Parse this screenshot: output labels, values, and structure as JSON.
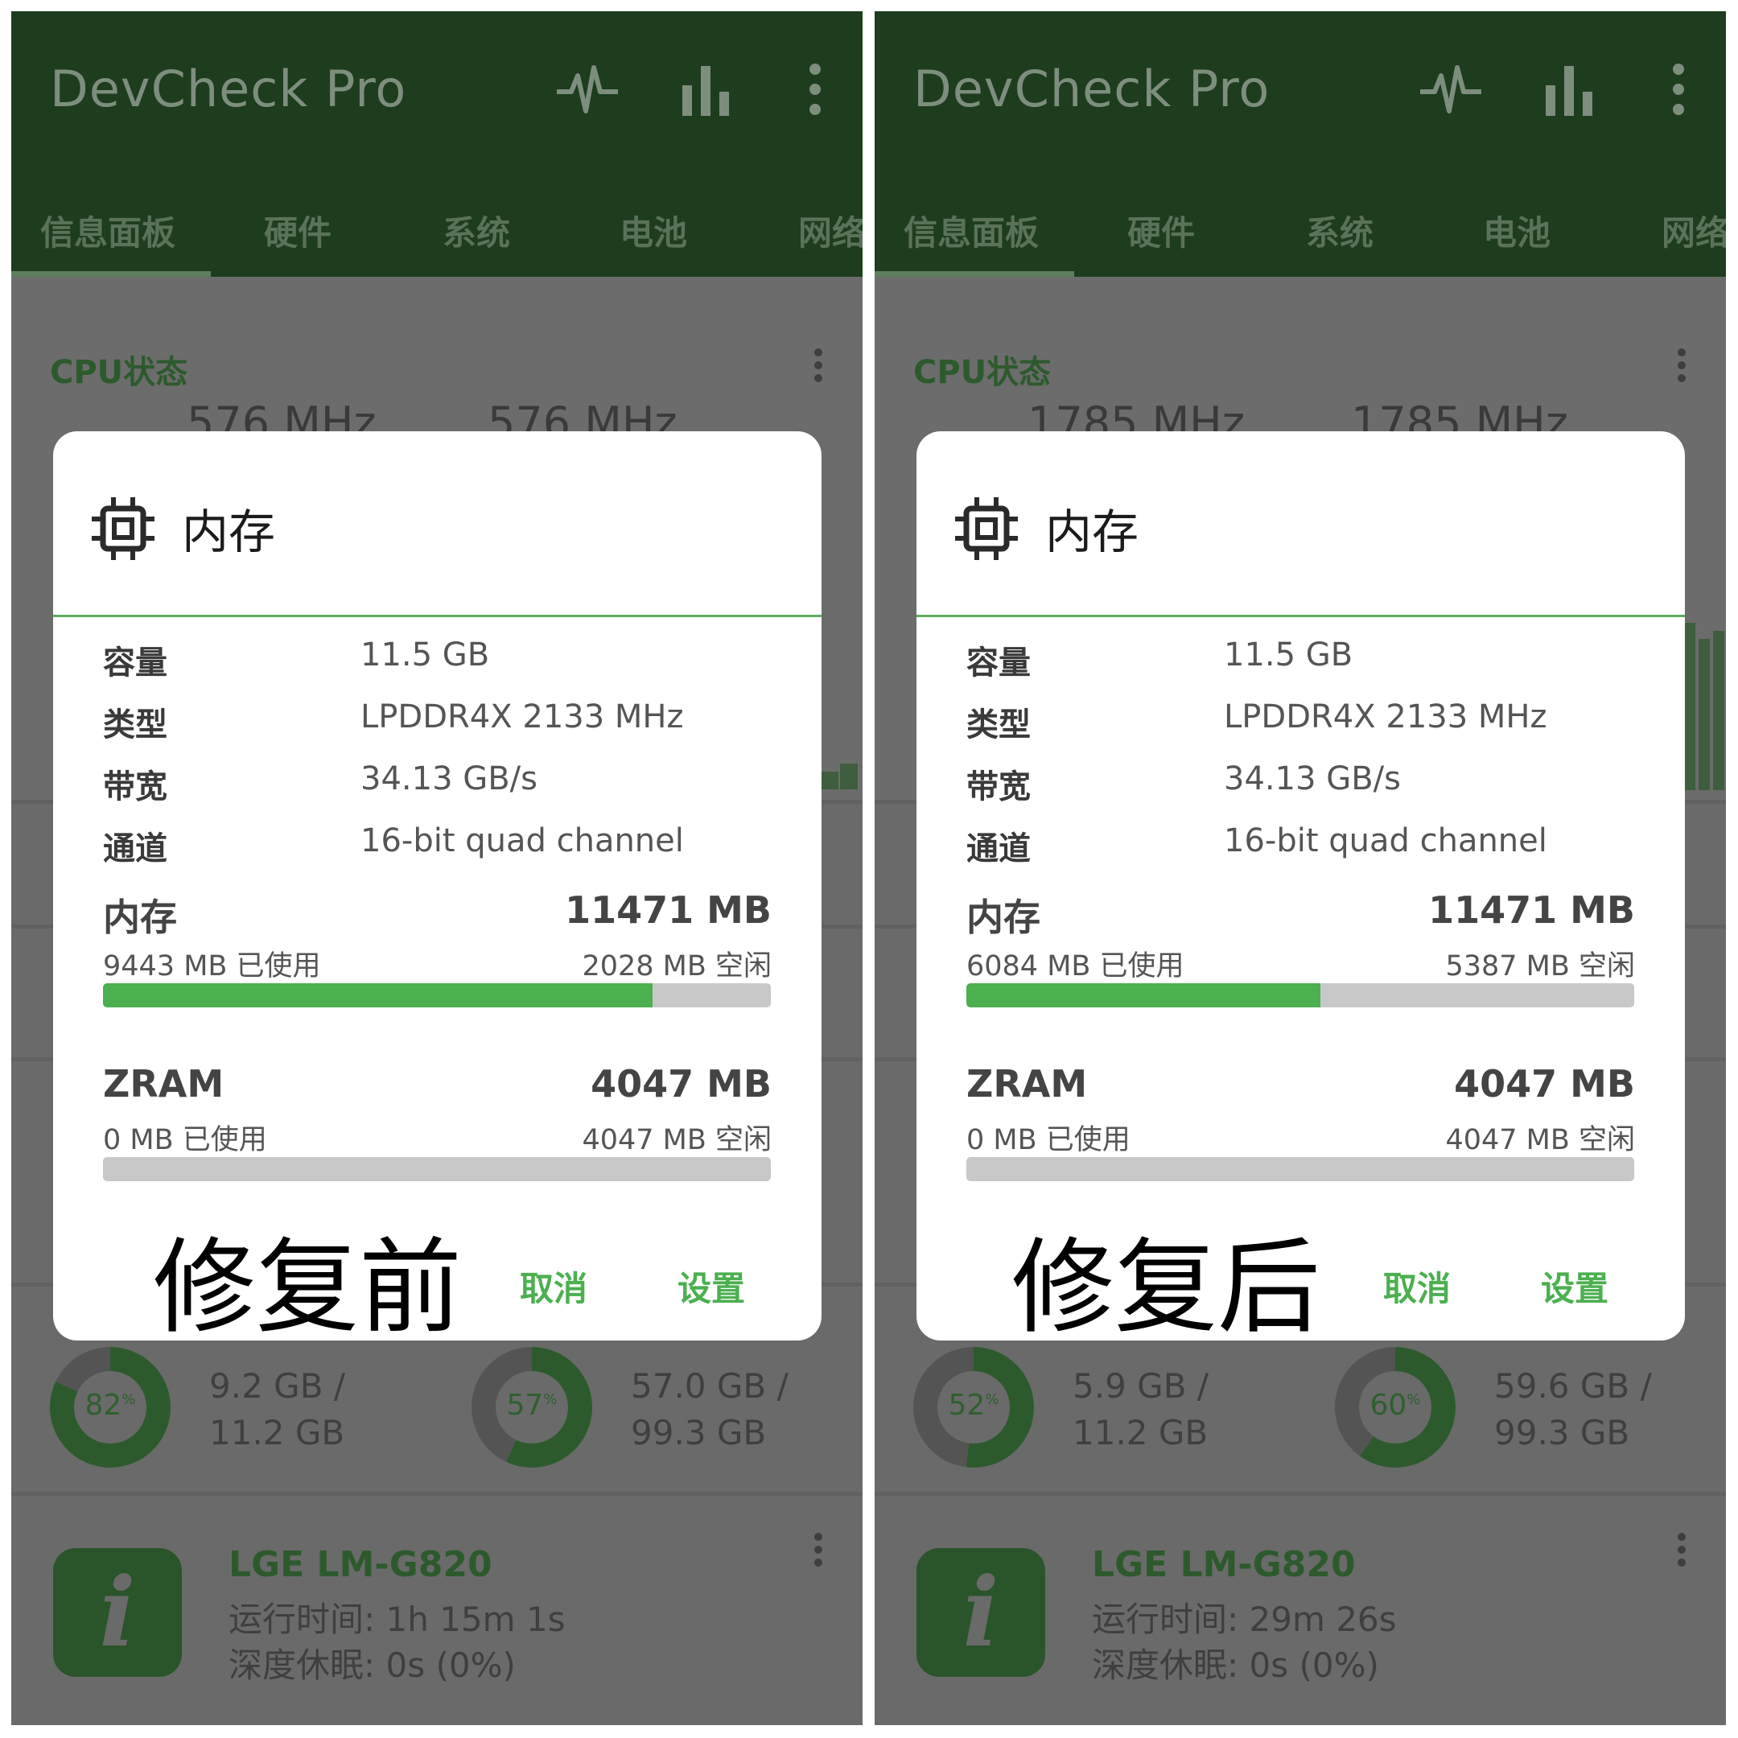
{
  "colors": {
    "accent": "#4caf50",
    "appbar": "#1e3c1e",
    "scrim": "#6a6a6a"
  },
  "panels": [
    {
      "app_title": "DevCheck Pro",
      "tabs": [
        "信息面板",
        "硬件",
        "系统",
        "电池",
        "网络"
      ],
      "cpu_title": "CPU状态",
      "cpu_freq_1": "576 MHz",
      "cpu_freq_2": "576 MHz",
      "dialog": {
        "title": "内存",
        "specs": [
          {
            "label": "容量",
            "value": "11.5 GB"
          },
          {
            "label": "类型",
            "value": "LPDDR4X 2133 MHz"
          },
          {
            "label": "带宽",
            "value": "34.13 GB/s"
          },
          {
            "label": "通道",
            "value": "16-bit quad channel"
          }
        ],
        "memory": {
          "name": "内存",
          "total": "11471 MB",
          "used": "9443 MB 已使用",
          "free": "2028 MB 空闲",
          "used_fraction": 0.823
        },
        "zram": {
          "name": "ZRAM",
          "total": "4047 MB",
          "used": "0 MB 已使用",
          "free": "4047 MB 空闲",
          "used_fraction": 0
        },
        "cancel_label": "取消",
        "settings_label": "设置",
        "caption": "修复前"
      },
      "ram_pct": "82",
      "ram_pct_value": 82,
      "ram_line1": "9.2 GB /",
      "ram_line2": "11.2 GB",
      "storage_pct": "57",
      "storage_pct_value": 57,
      "storage_line1": "57.0 GB /",
      "storage_line2": "99.3 GB",
      "device_name": "LGE LM-G820",
      "uptime": "运行时间: 1h 15m 1s",
      "deep_sleep": "深度休眠: 0s (0%)"
    },
    {
      "app_title": "DevCheck Pro",
      "tabs": [
        "信息面板",
        "硬件",
        "系统",
        "电池",
        "网络"
      ],
      "cpu_title": "CPU状态",
      "cpu_freq_1": "1785 MHz",
      "cpu_freq_2": "1785 MHz",
      "dialog": {
        "title": "内存",
        "specs": [
          {
            "label": "容量",
            "value": "11.5 GB"
          },
          {
            "label": "类型",
            "value": "LPDDR4X 2133 MHz"
          },
          {
            "label": "带宽",
            "value": "34.13 GB/s"
          },
          {
            "label": "通道",
            "value": "16-bit quad channel"
          }
        ],
        "memory": {
          "name": "内存",
          "total": "11471 MB",
          "used": "6084 MB 已使用",
          "free": "5387 MB 空闲",
          "used_fraction": 0.53
        },
        "zram": {
          "name": "ZRAM",
          "total": "4047 MB",
          "used": "0 MB 已使用",
          "free": "4047 MB 空闲",
          "used_fraction": 0
        },
        "cancel_label": "取消",
        "settings_label": "设置",
        "caption": "修复后"
      },
      "ram_pct": "52",
      "ram_pct_value": 52,
      "ram_line1": "5.9 GB /",
      "ram_line2": "11.2 GB",
      "storage_pct": "60",
      "storage_pct_value": 60,
      "storage_line1": "59.6 GB /",
      "storage_line2": "99.3 GB",
      "device_name": "LGE LM-G820",
      "uptime": "运行时间: 29m 26s",
      "deep_sleep": "深度休眠: 0s (0%)"
    }
  ]
}
